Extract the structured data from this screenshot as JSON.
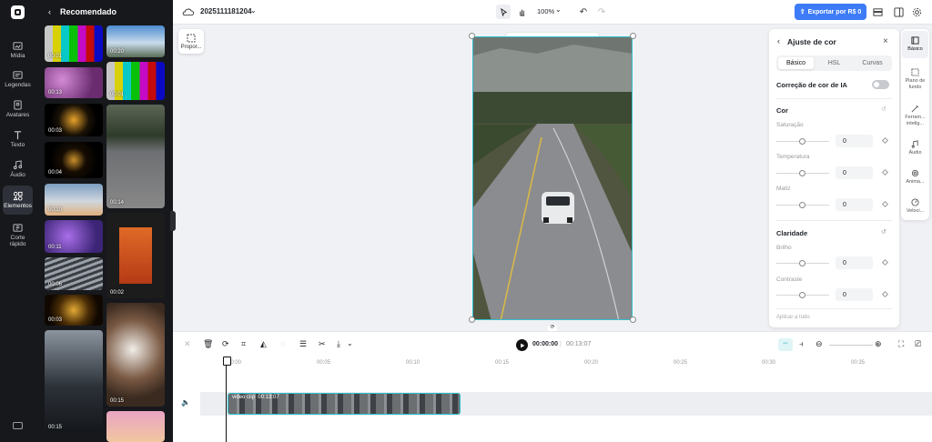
{
  "sidebar": {
    "items": [
      {
        "label": "Mídia"
      },
      {
        "label": "Legendas"
      },
      {
        "label": "Avatares"
      },
      {
        "label": "Texto"
      },
      {
        "label": "Áudio"
      },
      {
        "label": "Elementos"
      },
      {
        "label": "Corte rápido"
      }
    ]
  },
  "panel": {
    "title": "Recomendado",
    "thumbs_left": [
      "00:01",
      "00:13",
      "00:03",
      "00:04",
      "00:10",
      "00:11",
      "00:06",
      "00:03",
      "00:15"
    ],
    "thumbs_right": [
      "00:20",
      "00:01",
      "00:14",
      "00:02",
      "00:15"
    ]
  },
  "topbar": {
    "project_name": "2025111181204",
    "zoom": "100%",
    "export_label": "Exportar por R$ 0"
  },
  "canvas": {
    "ratio_label": "Propor..."
  },
  "adjust": {
    "title": "Ajuste de cor",
    "tabs": [
      "Básico",
      "HSL",
      "Curvas"
    ],
    "ai_label": "Correção de cor de IA",
    "cor_title": "Cor",
    "saturacao": {
      "label": "Saturação",
      "value": "0",
      "level": 0.5
    },
    "temperatura": {
      "label": "Temperatura",
      "value": "0",
      "level": 0.5
    },
    "matiz": {
      "label": "Matiz",
      "value": "0",
      "level": 0.5
    },
    "claridade_title": "Claridade",
    "brilho": {
      "label": "Brilho",
      "value": "0",
      "level": 0.5
    },
    "contraste": {
      "label": "Contraste",
      "value": "0",
      "level": 0.5
    },
    "apply_all": "Aplicar a tudo"
  },
  "sidetabs": [
    {
      "label": "Básico"
    },
    {
      "label": "Plano de fundo"
    },
    {
      "label": "Ferram... intelig..."
    },
    {
      "label": "Áudio"
    },
    {
      "label": "Anima..."
    },
    {
      "label": "Veloci..."
    }
  ],
  "timeline": {
    "current_time": "00:00:00",
    "total_time": "00:13:07",
    "ticks": [
      "00:00",
      "00:05",
      "00:10",
      "00:15",
      "00:20",
      "00:25",
      "00:30",
      "00:35"
    ],
    "clip_name": "video clip",
    "clip_duration": "00:13:07"
  },
  "colors": {
    "accent": "#3d7bf7",
    "selection": "#30c0cf"
  }
}
